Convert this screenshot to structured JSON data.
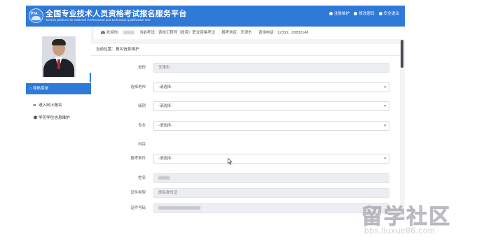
{
  "header": {
    "title": "全国专业技术人员资格考试报名服务平台",
    "subtitle": "Service platform for National Professional and technician qualification test",
    "logo_text": "PTA",
    "links": [
      "注册维护",
      "修改密码",
      "安全退出"
    ]
  },
  "infobar": {
    "welcome": "欢迎你：",
    "exam": "当前考试：咨询工程师（投资）职业资格考试",
    "region": "报考地区：天津市",
    "phone": "咨询电话：12333；83832148"
  },
  "sidebar": {
    "nav_title": "导航菜单",
    "items": [
      {
        "icon": "arrow-icon",
        "label": "进入网上报名"
      },
      {
        "icon": "graduation-cap-icon",
        "label": "学历学位信息维护"
      }
    ],
    "toggle_icon": "chevron-left-icon"
  },
  "content": {
    "breadcrumb": "当前位置：报名信息维护",
    "rows": [
      {
        "label": "省份",
        "value": "天津市",
        "type": "readonly"
      },
      {
        "label": "选择地市",
        "value": "-请选择-",
        "type": "select"
      },
      {
        "label": "级别",
        "value": "-请选择-",
        "type": "select"
      },
      {
        "label": "专业",
        "value": "-请选择-",
        "type": "select"
      },
      {
        "label": "科目",
        "value": "",
        "type": "none"
      },
      {
        "label": "报考条件",
        "value": "-请选择-",
        "type": "select"
      },
      {
        "label": "姓名",
        "value": "",
        "type": "blurred"
      },
      {
        "label": "证件类型",
        "value": "居民身份证",
        "type": "readonly"
      },
      {
        "label": "证件号码",
        "value": "",
        "type": "blurred"
      }
    ]
  },
  "watermark": {
    "main": "留学社区",
    "url": "bbs.liuxue86.com"
  },
  "colors": {
    "brand_blue": "#2f7ad8",
    "readonly_bg": "#eceef1",
    "frame_bg": "#f3f4f6"
  }
}
